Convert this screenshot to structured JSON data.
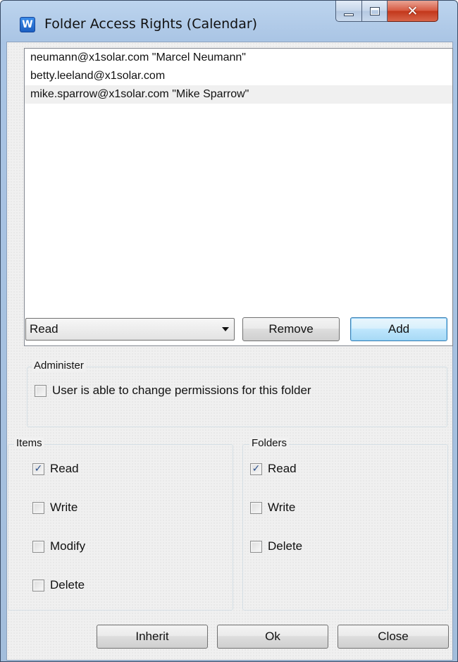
{
  "window": {
    "title": "Folder Access Rights (Calendar)",
    "icon_letter": "W"
  },
  "users": [
    {
      "label": "neumann@x1solar.com \"Marcel Neumann\"",
      "selected": false
    },
    {
      "label": "betty.leeland@x1solar.com",
      "selected": false
    },
    {
      "label": "mike.sparrow@x1solar.com \"Mike Sparrow\"",
      "selected": true
    }
  ],
  "controls": {
    "permission_level": "Read",
    "remove_label": "Remove",
    "add_label": "Add"
  },
  "administer": {
    "title": "Administer",
    "change_permissions_label": "User is able to change permissions for this folder",
    "change_permissions_checked": false
  },
  "items": {
    "title": "Items",
    "options": [
      {
        "label": "Read",
        "checked": true
      },
      {
        "label": "Write",
        "checked": false
      },
      {
        "label": "Modify",
        "checked": false
      },
      {
        "label": "Delete",
        "checked": false
      }
    ]
  },
  "folders": {
    "title": "Folders",
    "options": [
      {
        "label": "Read",
        "checked": true
      },
      {
        "label": "Write",
        "checked": false
      },
      {
        "label": "Delete",
        "checked": false
      }
    ]
  },
  "footer": {
    "inherit_label": "Inherit",
    "ok_label": "Ok",
    "close_label": "Close"
  }
}
